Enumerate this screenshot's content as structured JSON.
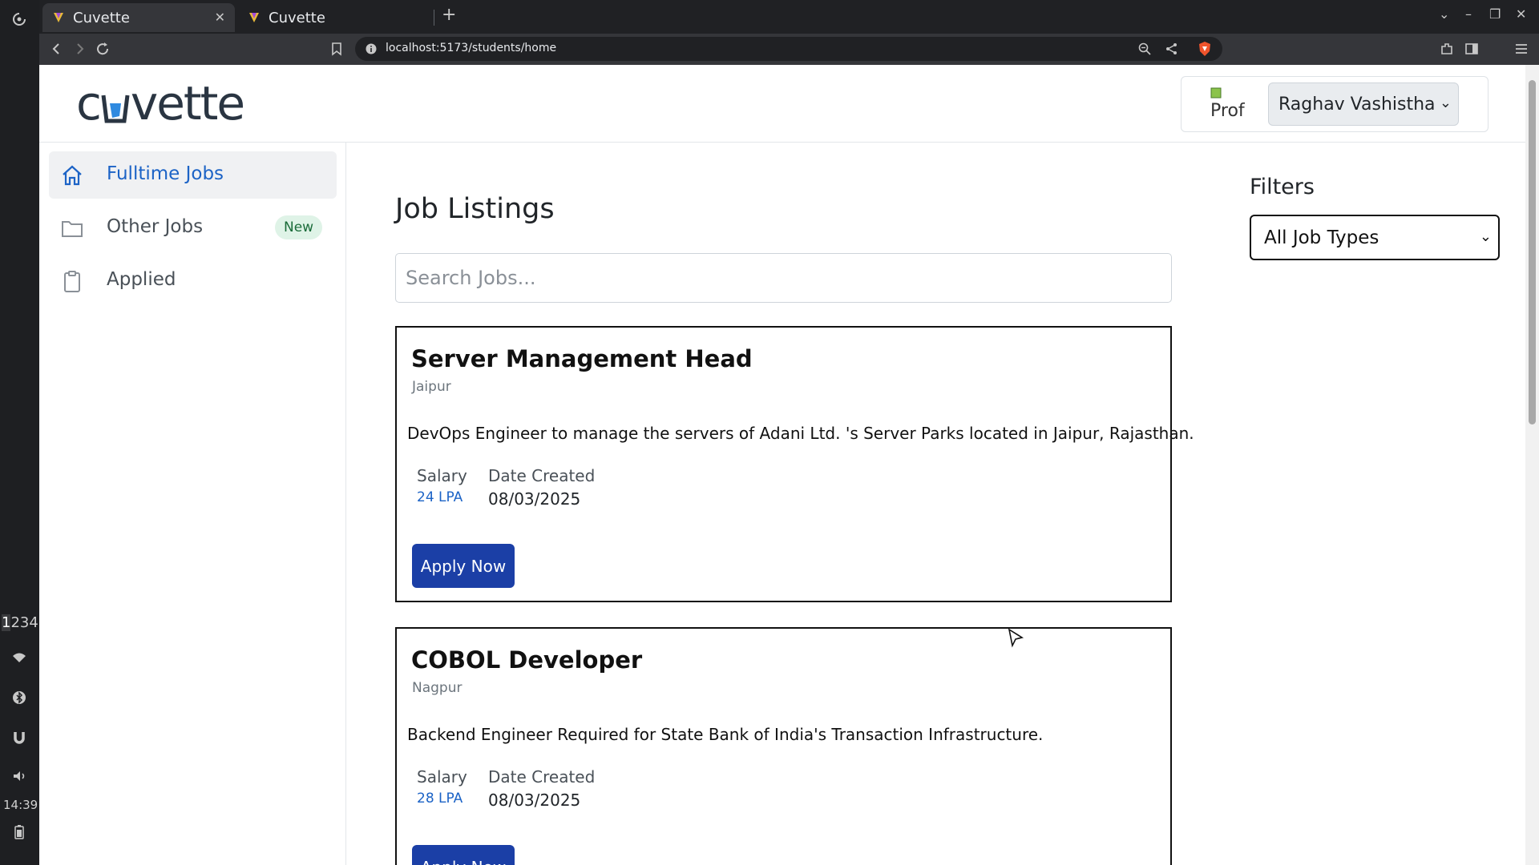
{
  "os": {
    "workspaces": [
      "1",
      "2",
      "3",
      "4"
    ],
    "clock": "14:39"
  },
  "browser": {
    "tabs": [
      {
        "title": "Cuvette",
        "active": true
      },
      {
        "title": "Cuvette",
        "active": false
      }
    ],
    "url": "localhost:5173/students/home"
  },
  "header": {
    "logo_text": "cuvette",
    "profile_image_alt": "Prof",
    "user_name": "Raghav Vashistha"
  },
  "sidebar": {
    "items": [
      {
        "label": "Fulltime Jobs",
        "icon": "home-icon",
        "active": true
      },
      {
        "label": "Other Jobs",
        "icon": "folder-icon",
        "badge": "New"
      },
      {
        "label": "Applied",
        "icon": "clipboard-icon"
      }
    ]
  },
  "main": {
    "title": "Job Listings",
    "search_placeholder": "Search Jobs...",
    "salary_label": "Salary",
    "date_label": "Date Created",
    "apply_label": "Apply Now",
    "jobs": [
      {
        "title": "Server Management Head",
        "location": "Jaipur",
        "description": "DevOps Engineer to manage the servers of Adani Ltd. 's Server Parks located in Jaipur, Rajasthan.",
        "salary": "24 LPA",
        "date": "08/03/2025"
      },
      {
        "title": "COBOL Developer",
        "location": "Nagpur",
        "description": "Backend Engineer Required for State Bank of India's Transaction Infrastructure.",
        "salary": "28 LPA",
        "date": "08/03/2025"
      }
    ]
  },
  "filters": {
    "title": "Filters",
    "job_type_selected": "All Job Types"
  },
  "colors": {
    "accent": "#1c63c6",
    "button": "#1b3fa6",
    "badge_bg": "#dff3e7",
    "badge_text": "#1b6c3a"
  }
}
